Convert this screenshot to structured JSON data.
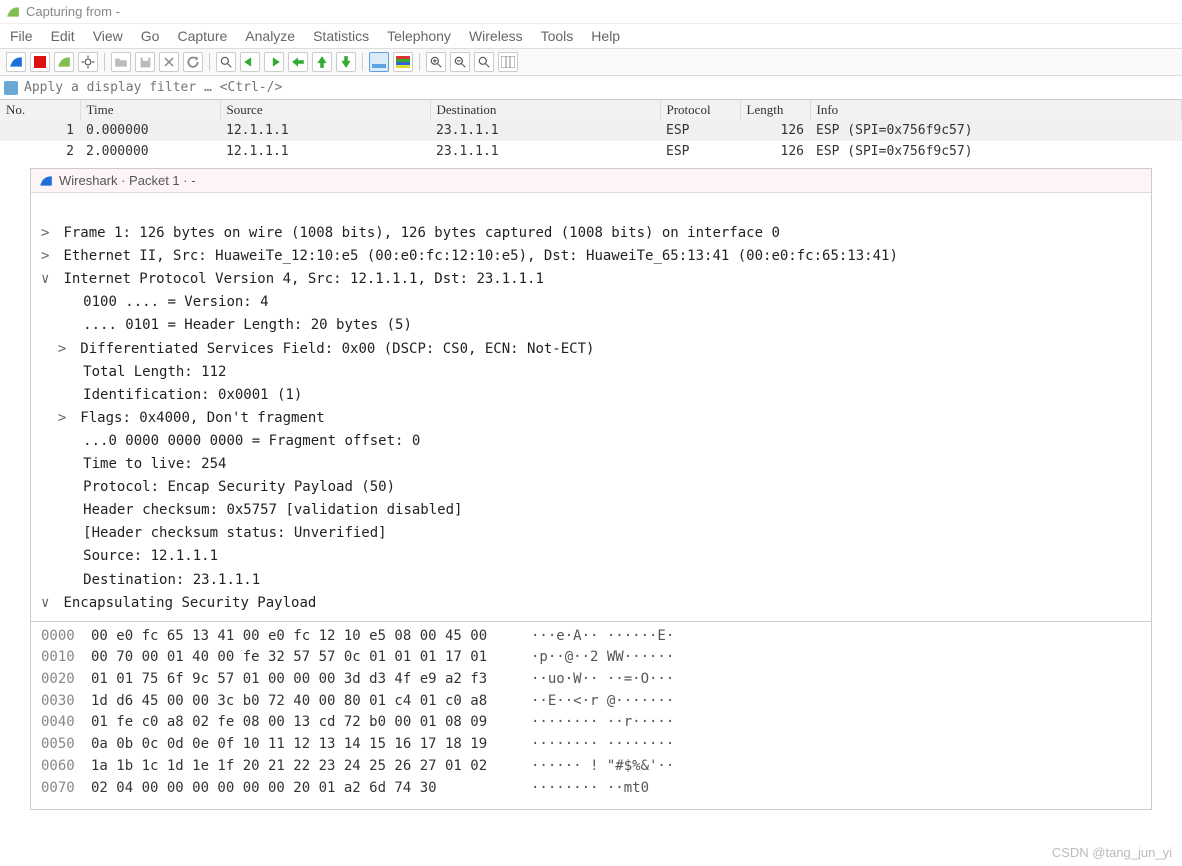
{
  "titlebar": {
    "text": "Capturing from -"
  },
  "menu": {
    "items": [
      "File",
      "Edit",
      "View",
      "Go",
      "Capture",
      "Analyze",
      "Statistics",
      "Telephony",
      "Wireless",
      "Tools",
      "Help"
    ]
  },
  "filter": {
    "placeholder": "Apply a display filter … <Ctrl-/>"
  },
  "columns": {
    "no": "No.",
    "time": "Time",
    "src": "Source",
    "dst": "Destination",
    "proto": "Protocol",
    "len": "Length",
    "info": "Info"
  },
  "packets": [
    {
      "no": "1",
      "time": "0.000000",
      "src": "12.1.1.1",
      "dst": "23.1.1.1",
      "proto": "ESP",
      "len": "126",
      "info": "ESP (SPI=0x756f9c57)"
    },
    {
      "no": "2",
      "time": "2.000000",
      "src": "12.1.1.1",
      "dst": "23.1.1.1",
      "proto": "ESP",
      "len": "126",
      "info": "ESP (SPI=0x756f9c57)"
    }
  ],
  "detail_title": "Wireshark · Packet 1 · -",
  "tree": {
    "frame": "Frame 1: 126 bytes on wire (1008 bits), 126 bytes captured (1008 bits) on interface 0",
    "eth": "Ethernet II, Src: HuaweiTe_12:10:e5 (00:e0:fc:12:10:e5), Dst: HuaweiTe_65:13:41 (00:e0:fc:65:13:41)",
    "ip": "Internet Protocol Version 4, Src: 12.1.1.1, Dst: 23.1.1.1",
    "ip_ver": "0100 .... = Version: 4",
    "ip_hl": ".... 0101 = Header Length: 20 bytes (5)",
    "ip_ds": "Differentiated Services Field: 0x00 (DSCP: CS0, ECN: Not-ECT)",
    "ip_tl": "Total Length: 112",
    "ip_id": "Identification: 0x0001 (1)",
    "ip_fl": "Flags: 0x4000, Don't fragment",
    "ip_fo": "...0 0000 0000 0000 = Fragment offset: 0",
    "ip_ttl": "Time to live: 254",
    "ip_pr": "Protocol: Encap Security Payload (50)",
    "ip_ck": "Header checksum: 0x5757 [validation disabled]",
    "ip_cks": "[Header checksum status: Unverified]",
    "ip_src": "Source: 12.1.1.1",
    "ip_dst": "Destination: 23.1.1.1",
    "esp": "Encapsulating Security Payload"
  },
  "hex": [
    {
      "off": "0000",
      "b": "00 e0 fc 65 13 41 00 e0  fc 12 10 e5 08 00 45 00",
      "a": "···e·A··  ······E·"
    },
    {
      "off": "0010",
      "b": "00 70 00 01 40 00 fe 32  57 57 0c 01 01 01 17 01",
      "a": "·p··@··2  WW······"
    },
    {
      "off": "0020",
      "b": "01 01 75 6f 9c 57 01 00  00 00 3d d3 4f e9 a2 f3",
      "a": "··uo·W··  ··=·O···"
    },
    {
      "off": "0030",
      "b": "1d d6 45 00 00 3c b0 72  40 00 80 01 c4 01 c0 a8",
      "a": "··E··<·r  @·······"
    },
    {
      "off": "0040",
      "b": "01 fe c0 a8 02 fe 08 00  13 cd 72 b0 00 01 08 09",
      "a": "········  ··r·····"
    },
    {
      "off": "0050",
      "b": "0a 0b 0c 0d 0e 0f 10 11  12 13 14 15 16 17 18 19",
      "a": "········  ········"
    },
    {
      "off": "0060",
      "b": "1a 1b 1c 1d 1e 1f 20 21  22 23 24 25 26 27 01 02",
      "a": "······ !  \"#$%&'··"
    },
    {
      "off": "0070",
      "b": "02 04 00 00 00 00 00 00  20 01 a2 6d 74 30",
      "a": "········   ··mt0"
    }
  ],
  "watermark": "CSDN @tang_jun_yi"
}
